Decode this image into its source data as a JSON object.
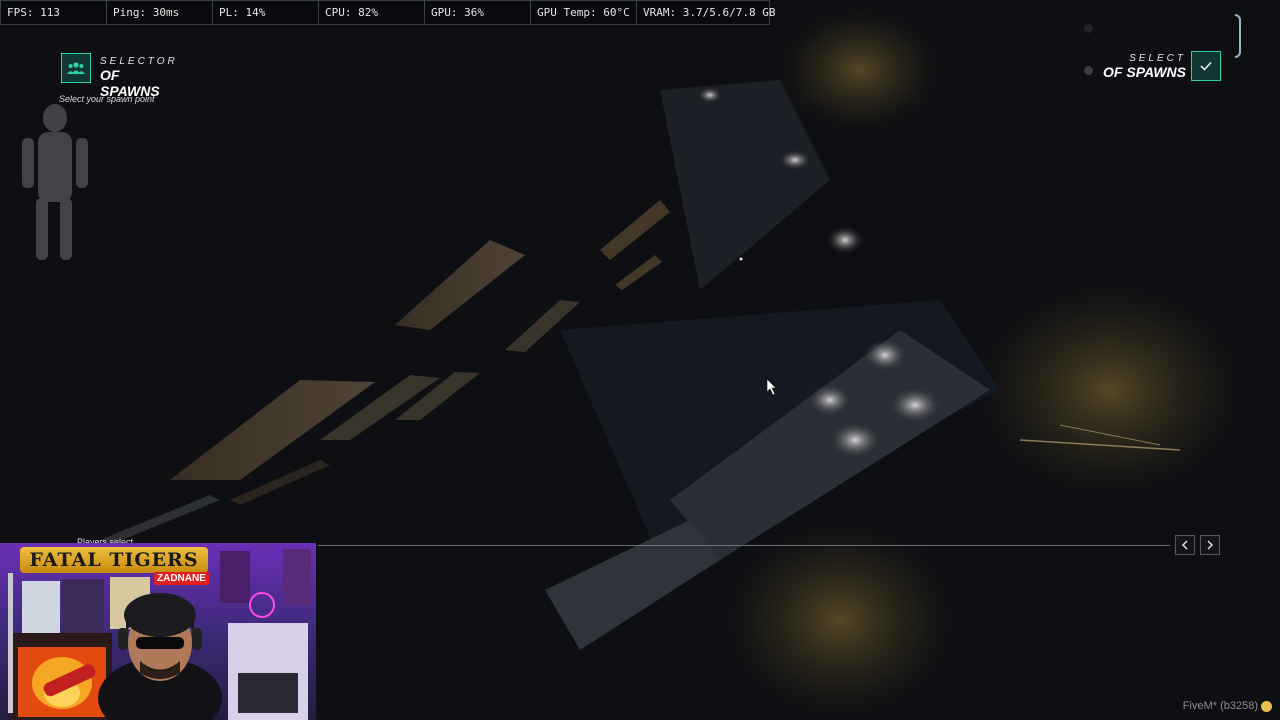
{
  "stats": [
    {
      "key": "fps",
      "text": "FPS: 113"
    },
    {
      "key": "ping",
      "text": "Ping: 30ms"
    },
    {
      "key": "pl",
      "text": "PL: 14%"
    },
    {
      "key": "cpu",
      "text": "CPU: 82%"
    },
    {
      "key": "gpu",
      "text": "GPU: 36%"
    },
    {
      "key": "gpu_temp",
      "text": "GPU Temp: 60°C"
    },
    {
      "key": "vram",
      "text": "VRAM: 3.7/5.6/7.8 GB"
    }
  ],
  "left_selector": {
    "title_small": "SELECTOR",
    "title_big": "OF SPAWNS",
    "subtitle": "Select your spawn point",
    "icon": "group-icon"
  },
  "right_selector": {
    "title_small": "SELECT",
    "title_big": "OF SPAWNS",
    "confirm_icon": "check-icon"
  },
  "timeline": {
    "label": "Players select",
    "prev_icon": "chevron-left-icon",
    "next_icon": "chevron-right-icon"
  },
  "webcam": {
    "banner": "FATAL TIGERS",
    "tag": "ZADNANE"
  },
  "footer": {
    "version": "FiveM* (b3258)"
  },
  "colors": {
    "accent": "#2fd0a8",
    "background": "#0d0e12"
  }
}
